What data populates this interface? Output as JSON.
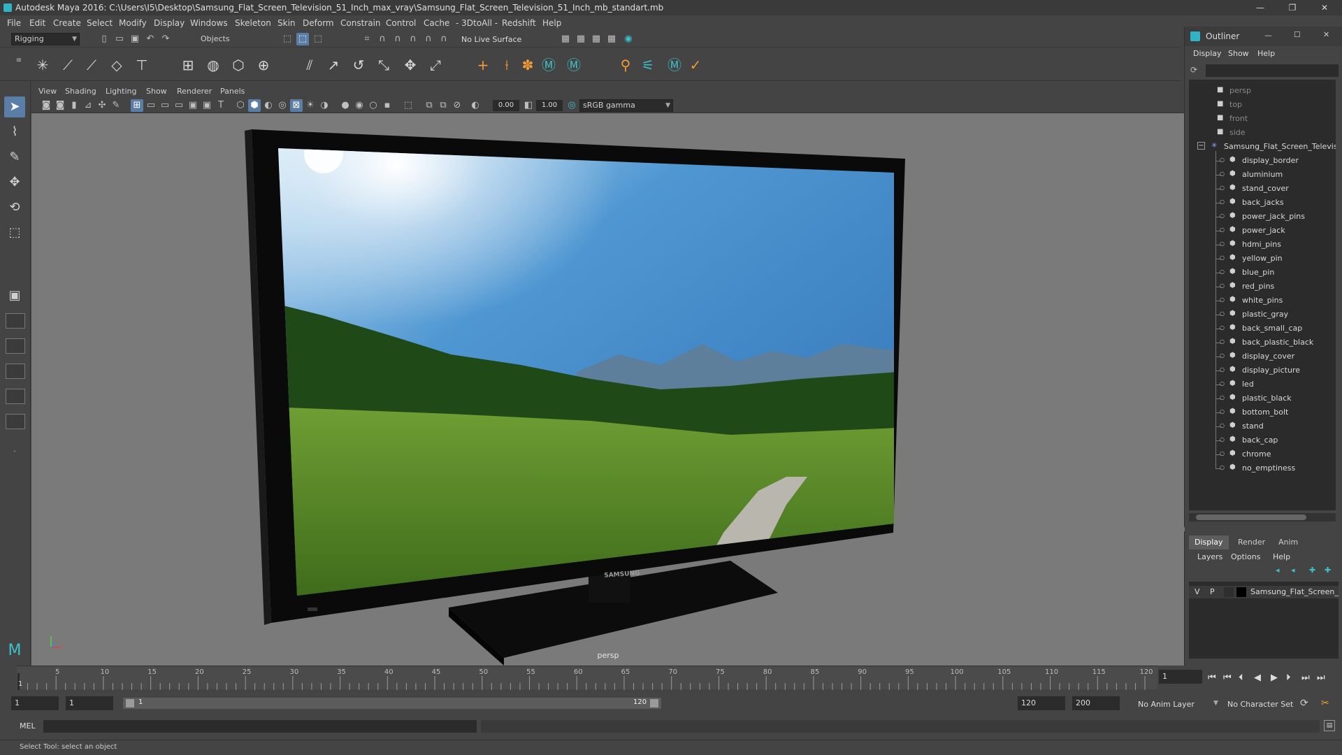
{
  "window": {
    "title": "Autodesk Maya 2016: C:\\Users\\I5\\Desktop\\Samsung_Flat_Screen_Television_51_Inch_max_vray\\Samsung_Flat_Screen_Television_51_Inch_mb_standart.mb",
    "minimize": "—",
    "restore": "❐",
    "close": "✕"
  },
  "menubar": [
    "File",
    "Edit",
    "Create",
    "Select",
    "Modify",
    "Display",
    "Windows",
    "Skeleton",
    "Skin",
    "Deform",
    "Constrain",
    "Control",
    "Cache",
    "- 3DtoAll -",
    "Redshift",
    "Help"
  ],
  "statusline": {
    "mode": "Rigging",
    "selection_mode": "Objects",
    "live_surface": "No Live Surface"
  },
  "viewport": {
    "menu": [
      "View",
      "Shading",
      "Lighting",
      "Show",
      "Renderer",
      "Panels"
    ],
    "exposure": "0.00",
    "gamma": "1.00",
    "color_space": "sRGB gamma",
    "camera_label": "persp",
    "brand_text": "SAMSUNG"
  },
  "outliner": {
    "title": "Outliner",
    "menu": [
      "Display",
      "Show",
      "Help"
    ],
    "cameras": [
      "persp",
      "top",
      "front",
      "side"
    ],
    "root": "Samsung_Flat_Screen_Televis",
    "children": [
      "display_border",
      "aluminium",
      "stand_cover",
      "back_jacks",
      "power_jack_pins",
      "power_jack",
      "hdmi_pins",
      "yellow_pin",
      "blue_pin",
      "red_pins",
      "white_pins",
      "plastic_gray",
      "back_small_cap",
      "back_plastic_black",
      "display_cover",
      "display_picture",
      "led",
      "plastic_black",
      "bottom_bolt",
      "stand",
      "back_cap",
      "chrome",
      "no_emptiness"
    ]
  },
  "layers": {
    "tabs": [
      "Display",
      "Render",
      "Anim"
    ],
    "menu": [
      "Layers",
      "Options",
      "Help"
    ],
    "layer_v": "V",
    "layer_p": "P",
    "layer_name": "Samsung_Flat_Screen_"
  },
  "timeslider": {
    "ticks": [
      "5",
      "10",
      "15",
      "20",
      "25",
      "30",
      "35",
      "40",
      "45",
      "50",
      "55",
      "60",
      "65",
      "70",
      "75",
      "80",
      "85",
      "90",
      "95",
      "100",
      "105",
      "110",
      "115",
      "120"
    ],
    "current_frame": "1",
    "current_frame_field": "1"
  },
  "range": {
    "start": "1",
    "playback_start": "1",
    "range_start_label": "1",
    "range_end_label": "120",
    "playback_end": "120",
    "end": "200",
    "anim_layer": "No Anim Layer",
    "char_set": "No Character Set"
  },
  "cmdline": {
    "label": "MEL"
  },
  "helpline": {
    "text": "Select Tool: select an object"
  }
}
